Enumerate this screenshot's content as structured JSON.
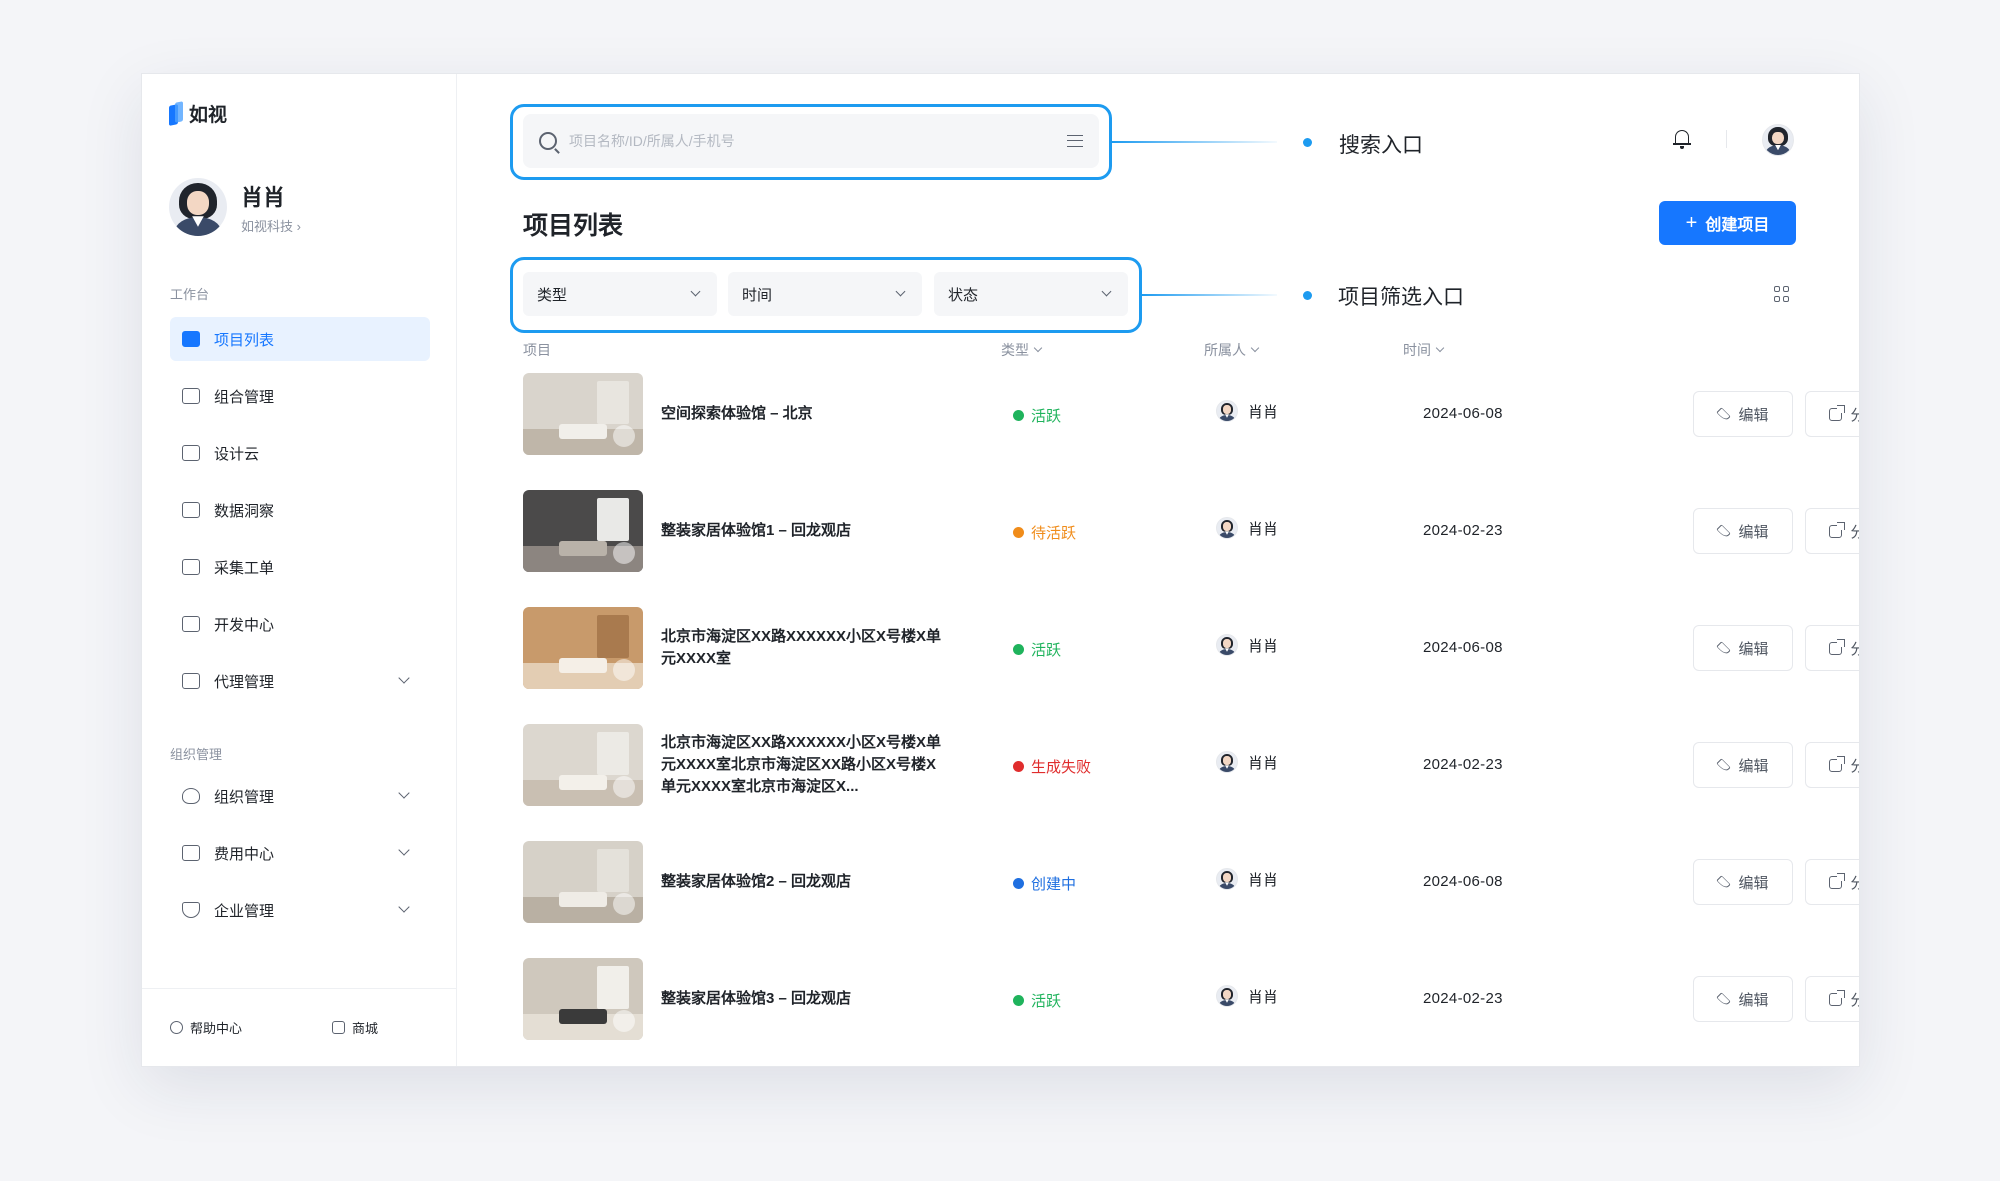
{
  "app": {
    "logo_text": "如视"
  },
  "profile": {
    "name": "肖肖",
    "org": "如视科技 ›"
  },
  "sidebar": {
    "section_workbench": "工作台",
    "section_org": "组织管理",
    "items": [
      {
        "label": "项目列表",
        "icon": "video-icon",
        "active": true
      },
      {
        "label": "组合管理",
        "icon": "folder-icon"
      },
      {
        "label": "设计云",
        "icon": "document-icon"
      },
      {
        "label": "数据洞察",
        "icon": "chart-icon"
      },
      {
        "label": "采集工单",
        "icon": "form-icon"
      },
      {
        "label": "开发中心",
        "icon": "monitor-icon"
      },
      {
        "label": "代理管理",
        "icon": "briefcase-icon",
        "expandable": true
      }
    ],
    "org_items": [
      {
        "label": "组织管理",
        "icon": "heart-icon",
        "expandable": true
      },
      {
        "label": "费用中心",
        "icon": "wallet-icon",
        "expandable": true
      },
      {
        "label": "企业管理",
        "icon": "shield-icon",
        "expandable": true
      }
    ],
    "footer": {
      "help": "帮助中心",
      "shop": "商城"
    }
  },
  "search": {
    "placeholder": "项目名称/ID/所属人/手机号",
    "value": ""
  },
  "annotations": {
    "search": "搜索入口",
    "filter": "项目筛选入口"
  },
  "page": {
    "title": "项目列表",
    "create_button": "创建项目"
  },
  "filters": [
    {
      "label": "类型"
    },
    {
      "label": "时间"
    },
    {
      "label": "状态"
    }
  ],
  "table": {
    "columns": {
      "project": "项目",
      "type": "类型",
      "owner": "所属人",
      "time": "时间"
    },
    "edit_label": "编辑",
    "share_label": "分享",
    "rows": [
      {
        "name": "空间探索体验馆 – 北京",
        "status": "活跃",
        "status_color": "#1fb35c",
        "owner": "肖肖",
        "date": "2024-06-08",
        "thumb": {
          "wall": "#d9d4cc",
          "floor": "#bfb6a9",
          "furn": "#f1efea",
          "win": "#e8e5df"
        }
      },
      {
        "name": "整装家居体验馆1 – 回龙观店",
        "status": "待活跃",
        "status_color": "#f08c1a",
        "owner": "肖肖",
        "date": "2024-02-23",
        "thumb": {
          "wall": "#4b4a4a",
          "floor": "#8c8580",
          "furn": "#b9b2a9",
          "win": "#e9e9e7"
        }
      },
      {
        "name": "北京市海淀区XX路XXXXXX小区X号楼X单元XXXX室",
        "status": "活跃",
        "status_color": "#1fb35c",
        "owner": "肖肖",
        "date": "2024-06-08",
        "thumb": {
          "wall": "#c89a6b",
          "floor": "#e3cdb3",
          "furn": "#f5efe7",
          "win": "#a97a4e"
        }
      },
      {
        "name": "北京市海淀区XX路XXXXXX小区X号楼X单元XXXX室北京市海淀区XX路小区X号楼X单元XXXX室北京市海淀区X...",
        "status": "生成失败",
        "status_color": "#e02d2d",
        "owner": "肖肖",
        "date": "2024-02-23",
        "thumb": {
          "wall": "#dcd7cf",
          "floor": "#c9bfb2",
          "furn": "#f3f0ea",
          "win": "#eceae5"
        }
      },
      {
        "name": "整装家居体验馆2 – 回龙观店",
        "status": "创建中",
        "status_color": "#1f6fe0",
        "owner": "肖肖",
        "date": "2024-06-08",
        "thumb": {
          "wall": "#d6d1c8",
          "floor": "#b9b0a3",
          "furn": "#efece6",
          "win": "#e4e1da"
        }
      },
      {
        "name": "整装家居体验馆3 – 回龙观店",
        "status": "活跃",
        "status_color": "#1fb35c",
        "owner": "肖肖",
        "date": "2024-02-23",
        "thumb": {
          "wall": "#cfc8bd",
          "floor": "#e4ded4",
          "furn": "#3a3a3a",
          "win": "#f1efea"
        }
      }
    ]
  }
}
